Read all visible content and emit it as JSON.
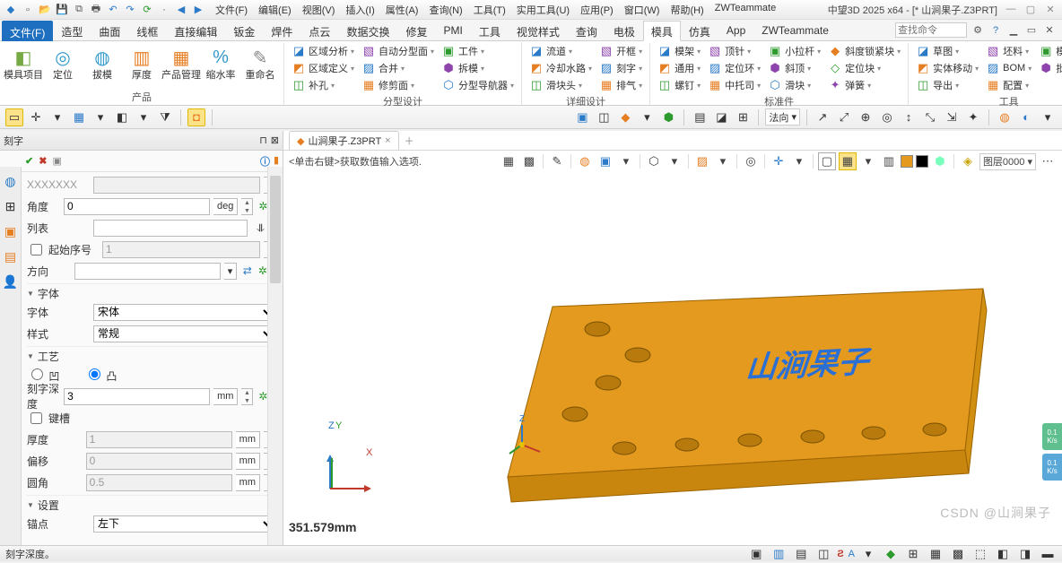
{
  "app_title": "中望3D 2025 x64 - [* 山涧果子.Z3PRT]",
  "menus": [
    "文件(F)",
    "编辑(E)",
    "视图(V)",
    "插入(I)",
    "属性(A)",
    "查询(N)",
    "工具(T)",
    "实用工具(U)",
    "应用(P)",
    "窗口(W)",
    "帮助(H)",
    "ZWTeammate"
  ],
  "ribbon_tabs": [
    "文件(F)",
    "造型",
    "曲面",
    "线框",
    "直接编辑",
    "钣金",
    "焊件",
    "点云",
    "数据交换",
    "修复",
    "PMI",
    "工具",
    "视觉样式",
    "查询",
    "电极",
    "模具",
    "仿真",
    "App",
    "ZWTeammate"
  ],
  "active_ribbon_tab": "模具",
  "search_placeholder": "查找命令",
  "ribbon_groups": {
    "g1": {
      "label": "产品",
      "big": [
        {
          "t": "模具项目",
          "c": "#7a4"
        },
        {
          "t": "定位",
          "c": "#39c"
        },
        {
          "t": "拔模",
          "c": "#39c"
        },
        {
          "t": "厚度",
          "c": "#e67e22"
        },
        {
          "t": "产品管理",
          "c": "#e67e22"
        },
        {
          "t": "缩水率",
          "c": "#39c"
        },
        {
          "t": "重命名",
          "c": "#888"
        }
      ]
    },
    "g2": {
      "label": "分型设计",
      "cols": [
        [
          {
            "t": "区域分析"
          },
          {
            "t": "区域定义"
          },
          {
            "t": "补孔"
          }
        ],
        [
          {
            "t": "自动分型面"
          },
          {
            "t": "合并"
          },
          {
            "t": "修剪面"
          }
        ],
        [
          {
            "t": "工件"
          },
          {
            "t": "拆模"
          },
          {
            "t": "分型导航器"
          }
        ]
      ]
    },
    "g3": {
      "label": "详细设计",
      "cols": [
        [
          {
            "t": "流道"
          },
          {
            "t": "冷却水路"
          },
          {
            "t": "滑块头"
          }
        ],
        [
          {
            "t": "开框"
          },
          {
            "t": "刻字"
          },
          {
            "t": "排气"
          }
        ]
      ]
    },
    "g4": {
      "label": "标准件",
      "cols": [
        [
          {
            "t": "模架"
          },
          {
            "t": "通用"
          },
          {
            "t": "螺钉"
          }
        ],
        [
          {
            "t": "顶针"
          },
          {
            "t": "定位环"
          },
          {
            "t": "中托司"
          }
        ],
        [
          {
            "t": "小拉杆"
          },
          {
            "t": "斜顶"
          },
          {
            "t": "滑块"
          }
        ],
        [
          {
            "t": "斜度锁紧块"
          },
          {
            "t": "定位块"
          },
          {
            "t": "弹簧"
          }
        ]
      ]
    },
    "g5": {
      "label": "工具",
      "cols": [
        [
          {
            "t": "草图"
          },
          {
            "t": "实体移动"
          },
          {
            "t": "导出"
          }
        ],
        [
          {
            "t": "坯料"
          },
          {
            "t": "BOM"
          },
          {
            "t": "配置"
          }
        ],
        [
          {
            "t": "模具出图"
          },
          {
            "t": "批量简化"
          }
        ]
      ]
    }
  },
  "quickbar_direction_label": "法向",
  "panel_title": "刻字",
  "document_tab": "山涧果子.Z3PRT",
  "hint": "<单击右键>获取数值输入选项.",
  "layer_value": "图层0000",
  "panel": {
    "angle_label": "角度",
    "angle_value": "0",
    "angle_unit": "deg",
    "list_label": "列表",
    "list_value": "",
    "startno_label": "起始序号",
    "startno_value": "1",
    "dir_label": "方向",
    "dir_value": "",
    "font_section": "字体",
    "font_label": "字体",
    "font_value": "宋体",
    "style_label": "样式",
    "style_value": "常规",
    "proc_section": "工艺",
    "opt_concave": "凹",
    "opt_convex": "凸",
    "depth_label": "刻字深度",
    "depth_value": "3",
    "unit_mm": "mm",
    "keyslot_label": "键槽",
    "thick_label": "厚度",
    "thick_value": "1",
    "offset_label": "偏移",
    "offset_value": "0",
    "fillet_label": "圆角",
    "fillet_value": "0.5",
    "setting_section": "设置",
    "anchor_label": "锚点",
    "anchor_value": "左下"
  },
  "engrave_text": "山涧果子",
  "coord_readout": "351.579mm",
  "status_text": "刻字深度。",
  "side": {
    "a": "0.1",
    "au": "K/s",
    "b": "0.1",
    "bu": "K/s"
  },
  "watermark": "CSDN @山涧果子",
  "colors": {
    "plate": "#e39a1f",
    "plate_side": "#c8860f",
    "engrave": "#2a6fd6"
  }
}
